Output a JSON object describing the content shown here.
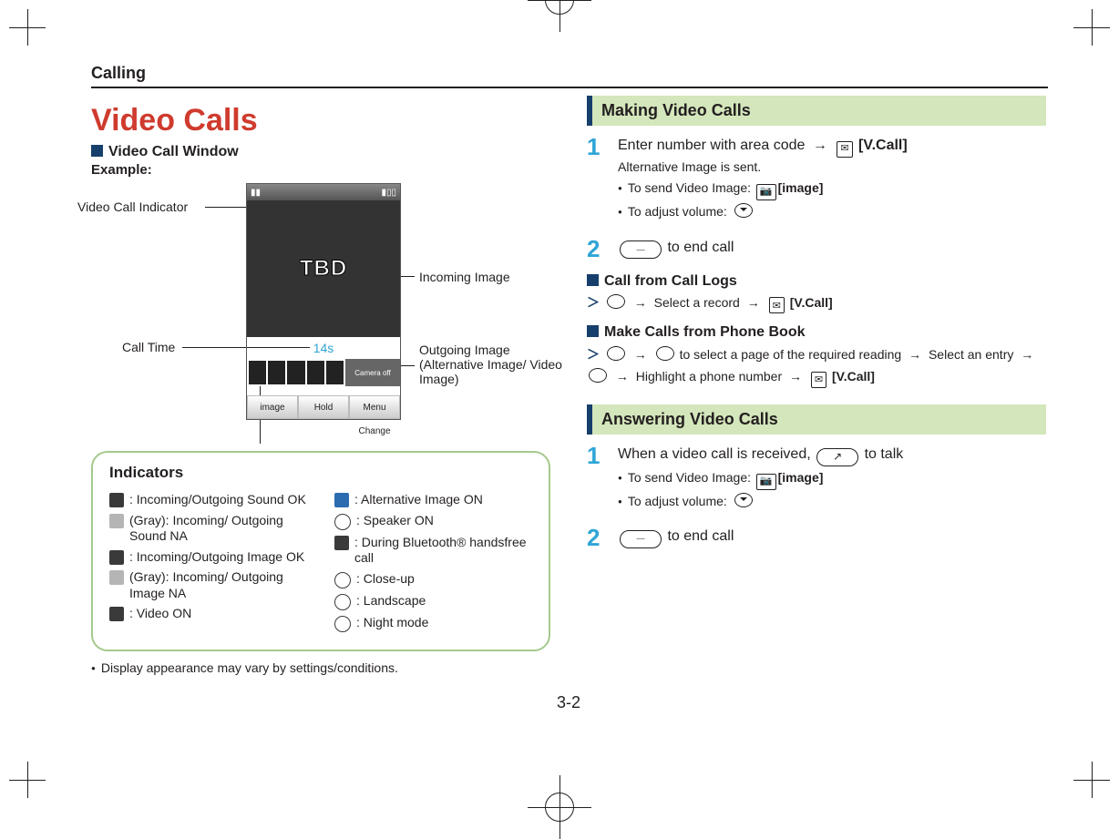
{
  "header": {
    "section": "Calling"
  },
  "left": {
    "title": "Video Calls",
    "windowTitle": "Video Call Window",
    "example": "Example:",
    "labels": {
      "vci": "Video Call Indicator",
      "callTime": "Call Time",
      "incoming": "Incoming Image",
      "outgoing": "Outgoing Image (Alternative Image/ Video Image)"
    },
    "shot": {
      "tbd": "TBD",
      "time": "14s",
      "camoff": "Camera off",
      "sk1": "image",
      "sk2": "Hold",
      "sk3": "Menu Change"
    },
    "indicators": {
      "title": "Indicators",
      "colA": [
        {
          "icon": "dk",
          "text": ": Incoming/Outgoing Sound OK"
        },
        {
          "icon": "g",
          "text": "(Gray): Incoming/ Outgoing Sound NA"
        },
        {
          "icon": "dk",
          "text": ": Incoming/Outgoing Image OK"
        },
        {
          "icon": "g",
          "text": "(Gray): Incoming/ Outgoing Image NA"
        },
        {
          "icon": "dk",
          "text": ": Video ON"
        }
      ],
      "colB": [
        {
          "icon": "blue",
          "text": ": Alternative Image ON"
        },
        {
          "icon": "rnd",
          "text": ": Speaker ON"
        },
        {
          "icon": "dk",
          "text": ": During Bluetooth® handsfree call"
        },
        {
          "icon": "rnd",
          "text": ": Close-up"
        },
        {
          "icon": "rnd",
          "text": ": Landscape"
        },
        {
          "icon": "rnd",
          "text": ": Night mode"
        }
      ]
    },
    "note": "Display appearance may vary by settings/conditions."
  },
  "right": {
    "making": {
      "bar": "Making Video Calls",
      "step1_a": "Enter number with area code",
      "step1_b": "[V.Call]",
      "alt": "Alternative Image is sent.",
      "b1": "To send Video Image:",
      "b1k": "[image]",
      "b2": "To adjust volume:",
      "step2": "to end call",
      "callLogs": "Call from Call Logs",
      "cl_text": "Select a record",
      "cl_key": "[V.Call]",
      "phoneBook": "Make Calls from Phone Book",
      "pb_a": "to select a page of the required reading",
      "pb_b": "Select an entry",
      "pb_c": "Highlight a phone number",
      "pb_key": "[V.Call]"
    },
    "answering": {
      "bar": "Answering Video Calls",
      "s1a": "When a video call is received,",
      "s1b": "to talk",
      "b1": "To send Video Image:",
      "b1k": "[image]",
      "b2": "To adjust volume:",
      "s2": "to end call"
    }
  },
  "pageNumber": "3-2"
}
